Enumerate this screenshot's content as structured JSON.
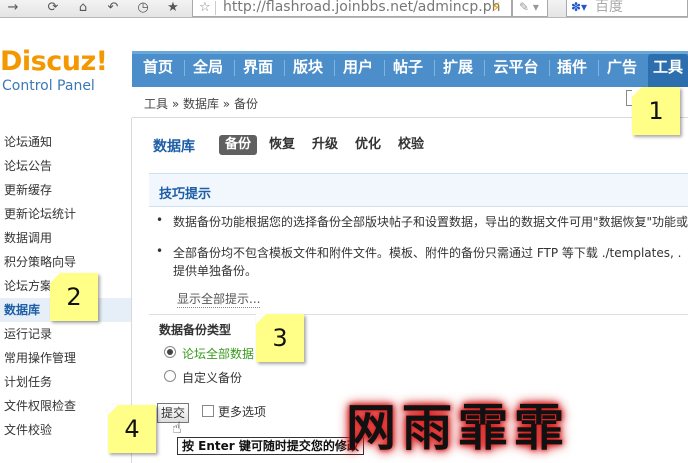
{
  "browser": {
    "url": "http://flashroad.joinbbs.net/admincp.ph",
    "search_placeholder": "百度"
  },
  "header": {
    "logo": "Discuz!",
    "logo_sub": "Control Panel",
    "nav": [
      "首页",
      "全局",
      "界面",
      "版块",
      "用户",
      "帖子",
      "扩展",
      "云平台",
      "插件",
      "广告",
      "工具"
    ],
    "active_nav": "工具"
  },
  "breadcrumb": "工具 » 数据库 » 备份",
  "sidebar": {
    "items": [
      "论坛通知",
      "论坛公告",
      "更新缓存",
      "更新论坛统计",
      "数据调用",
      "积分策略向导",
      "论坛方案",
      "数据库",
      "运行记录",
      "常用操作管理",
      "计划任务",
      "文件权限检查",
      "文件校验"
    ],
    "active": "数据库"
  },
  "main": {
    "title": "数据库",
    "tabs": [
      "备份",
      "恢复",
      "升级",
      "优化",
      "校验"
    ],
    "active_tab": "备份",
    "tips_title": "技巧提示",
    "tips": [
      "数据备份功能根据您的选择备份全部版块帖子和设置数据，导出的数据文件可用\"数据恢复\"功能或",
      "全部备份均不包含模板文件和附件文件。模板、附件的备份只需通过 FTP 等下载 ./templates, .",
      "提供单独备份。"
    ],
    "show_all": "显示全部提示...",
    "backup_type_label": "数据备份类型",
    "options": [
      "论坛全部数据",
      "自定义备份"
    ],
    "selected_option": "论坛全部数据",
    "submit_label": "提交",
    "more_options": "更多选项",
    "hover_tip": "按 Enter 键可随时提交您的修改"
  },
  "notes": [
    "1",
    "2",
    "3",
    "4"
  ],
  "watermark": "网雨霏霏"
}
